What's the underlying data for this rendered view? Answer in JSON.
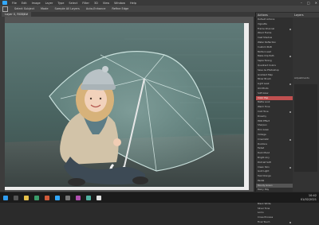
{
  "app": {
    "menu": [
      "File",
      "Edit",
      "Image",
      "Layer",
      "Type",
      "Select",
      "Filter",
      "3D",
      "View",
      "Window",
      "Help"
    ]
  },
  "options": {
    "items": [
      "Select Subject",
      "Mode",
      "Sample All Layers",
      "Auto-Enhance",
      "Refine Edge"
    ]
  },
  "document": {
    "tab_title": "Layer 0, RGB/8#"
  },
  "panel_actions": {
    "title": "Actions",
    "items": [
      "Default Actions",
      "Vignette",
      "Frame Channel",
      "Wood Frame",
      "Cast Shadow",
      "Water Reflection",
      "Custom RGB",
      "Molten Lead",
      "Make Clip Path",
      "Sepia Toning",
      "Quadrant Colors",
      "Save As Photoshop",
      "Gradient Map",
      "Mixer Brush",
      "Light Leak",
      "Old Photo",
      "Soft Glow",
      "Color Pop",
      "Matte Look",
      "Warm Tone",
      "Cold Tone",
      "Dreamy",
      "HDR Effect",
      "Sharpen",
      "Film Grain",
      "Vintage",
      "Cinematic",
      "Duotone",
      "Faded",
      "Dark Mood",
      "Bright Airy",
      "Portrait Soft",
      "Clean Skin",
      "Gold Light",
      "Teal Orange",
      "Pastel",
      "Moody Green",
      "Rainy Day",
      "Winter Look",
      "Autumn Look",
      "Black White",
      "Silver Tone",
      "Lomo",
      "Cross Process",
      "Final Touch"
    ],
    "active_index": 17,
    "selected_index": 36
  },
  "panel_layers": {
    "title": "Layers",
    "sub": "Adjustments"
  },
  "taskbar": {
    "time": "10:42",
    "date": "01/02/2021"
  }
}
